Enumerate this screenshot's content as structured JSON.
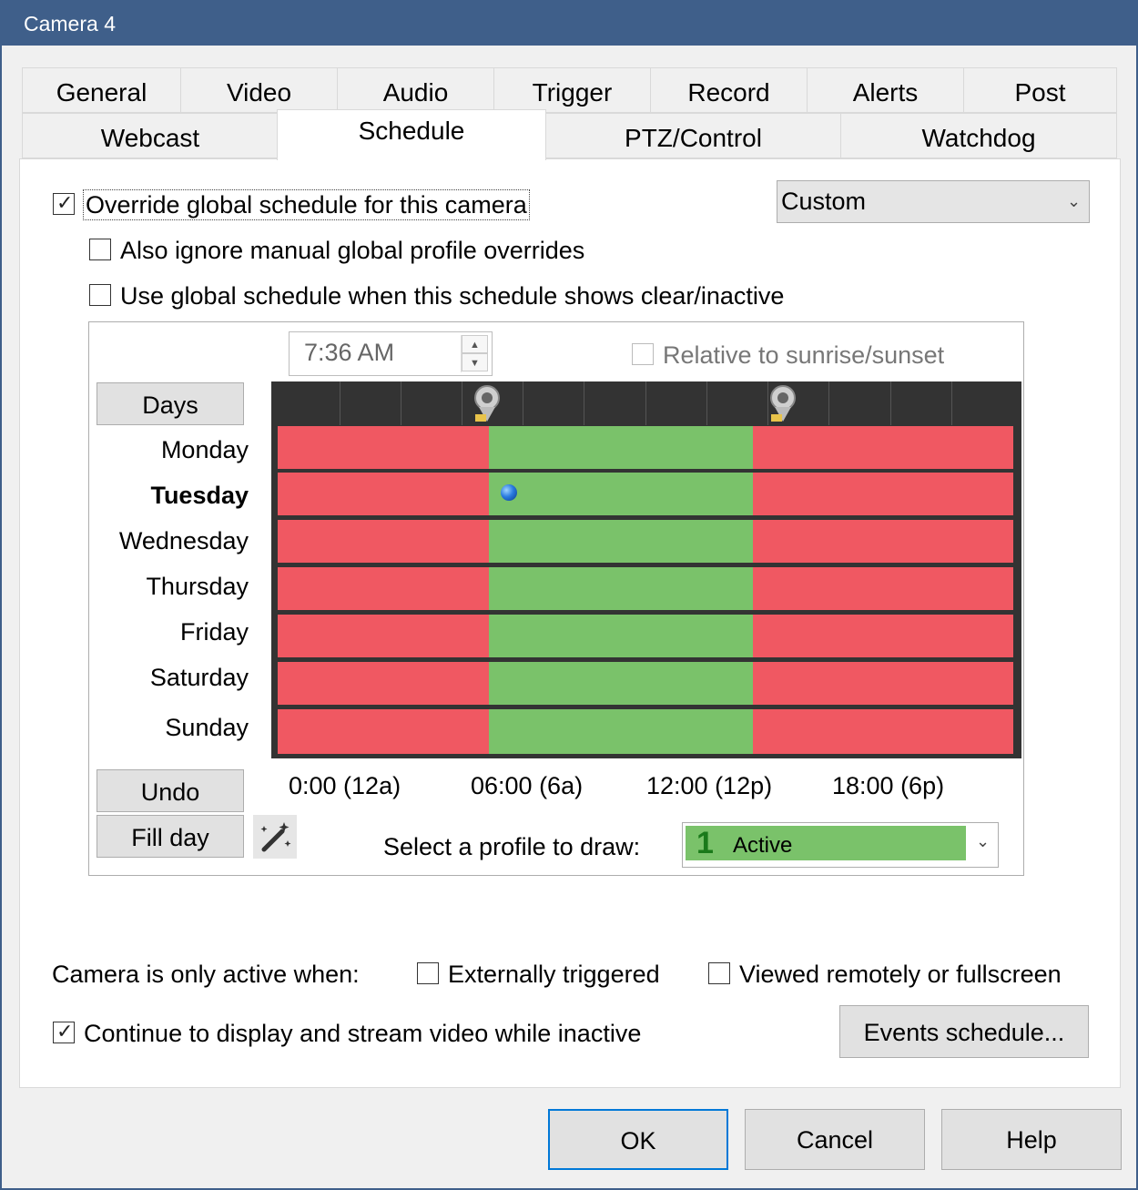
{
  "window": {
    "title": "Camera 4"
  },
  "tabs_row1": [
    "General",
    "Video",
    "Audio",
    "Trigger",
    "Record",
    "Alerts",
    "Post"
  ],
  "tabs_row2": [
    "Webcast",
    "Schedule",
    "PTZ/Control",
    "Watchdog"
  ],
  "selected_tab": "Schedule",
  "override": {
    "label": "Override global schedule for this camera",
    "checked": true
  },
  "schedule_select": {
    "value": "Custom"
  },
  "ignore_manual": {
    "label": "Also ignore manual global profile overrides",
    "checked": false
  },
  "use_global": {
    "label": "Use global schedule when this schedule shows clear/inactive",
    "checked": false
  },
  "time_spinner": {
    "value": "7:36 AM"
  },
  "relative_sun": {
    "label": "Relative to sunrise/sunset",
    "checked": false,
    "enabled": false
  },
  "days_button": "Days",
  "days": [
    "Monday",
    "Tuesday",
    "Wednesday",
    "Thursday",
    "Friday",
    "Saturday",
    "Sunday"
  ],
  "current_day": "Tuesday",
  "schedule_rows": {
    "profiles": {
      "inactive_color": "#f05862",
      "active_color": "#7ac26a"
    },
    "active_start_hour": 6.9,
    "active_end_hour": 15.5
  },
  "time_labels": [
    "0:00 (12a)",
    "06:00 (6a)",
    "12:00 (12p)",
    "18:00 (6p)"
  ],
  "undo_button": "Undo",
  "fill_day_button": "Fill day",
  "wand_icon": "magic-wand-icon",
  "profile_draw": {
    "label": "Select a profile to draw:",
    "number": "1",
    "name": "Active"
  },
  "active_when": {
    "label": "Camera is only active when:"
  },
  "externally_triggered": {
    "label": "Externally triggered",
    "checked": false
  },
  "viewed_remotely": {
    "label": "Viewed remotely or fullscreen",
    "checked": false
  },
  "continue_display": {
    "label": "Continue to display and stream video while inactive",
    "checked": true
  },
  "events_button": "Events schedule...",
  "footer": {
    "ok": "OK",
    "cancel": "Cancel",
    "help": "Help"
  }
}
